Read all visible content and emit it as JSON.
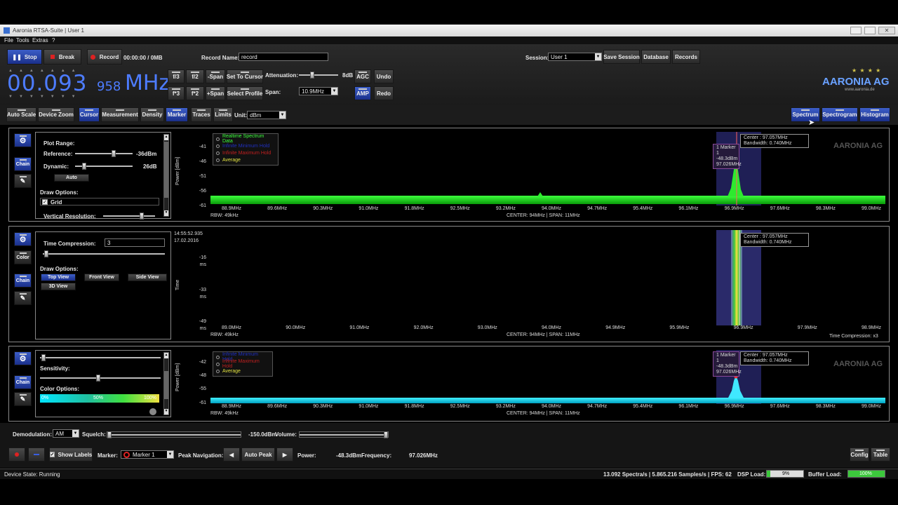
{
  "window": {
    "title": "Aaronia RTSA-Suite | User 1"
  },
  "menu": [
    "File",
    "Tools",
    "Extras",
    "?"
  ],
  "toolbar": {
    "stop": "Stop",
    "break": "Break",
    "record": "Record",
    "time": "00:00:00 / 0MB",
    "record_name_label": "Record Name:",
    "record_name_value": "record",
    "session_label": "Session:",
    "session_value": "User 1",
    "save_session": "Save Session",
    "database": "Database",
    "records": "Records"
  },
  "freq": {
    "main": "00.093",
    "sub": "958",
    "unit": "MHz"
  },
  "freq_buttons": {
    "f3": "f/3",
    "f2": "f/2",
    "mspan": "-Span",
    "set_cursor": "Set To Cursor",
    "x3": "f*3",
    "x2": "f*2",
    "pspan": "+Span",
    "select_profile": "Select Profile"
  },
  "atten": {
    "label": "Attenuation:",
    "value": "8dB",
    "agc": "AGC",
    "amp": "AMP",
    "undo": "Undo",
    "redo": "Redo",
    "span_label": "Span:",
    "span_value": "10.9MHz"
  },
  "logo": {
    "text": "AARONIA AG",
    "sub": "www.aaronia.de"
  },
  "tabs": {
    "auto_scale": "Auto Scale",
    "device_zoom": "Device Zoom",
    "cursor": "Cursor",
    "measurement": "Measurement",
    "density": "Density",
    "marker": "Marker",
    "traces": "Traces",
    "limits": "Limits",
    "unit_label": "Unit:",
    "unit_value": "dBm",
    "spectrum": "Spectrum",
    "spectrogram": "Spectrogram",
    "histogram": "Histogram"
  },
  "side": {
    "chain": "Chain",
    "color": "Color"
  },
  "panel1": {
    "plot_range": "Plot Range:",
    "reference": "Reference:",
    "reference_val": "-36dBm",
    "dynamic": "Dynamic:",
    "dynamic_val": "26dB",
    "auto": "Auto",
    "draw_options": "Draw Options:",
    "grid": "Grid",
    "vres": "Vertical Resolution:",
    "ylabel": "Power [dBm]",
    "yticks": [
      "-41",
      "-46",
      "-51",
      "-56",
      "-61"
    ],
    "xticks": [
      "88.9MHz",
      "89.6MHz",
      "90.3MHz",
      "91.0MHz",
      "91.8MHz",
      "92.5MHz",
      "93.2MHz",
      "94.0MHz",
      "94.7MHz",
      "95.4MHz",
      "96.1MHz",
      "96.9MHz",
      "97.6MHz",
      "98.3MHz",
      "99.0MHz"
    ],
    "rbw": "RBW: 49kHz",
    "center": "CENTER: 94MHz  |  SPAN: 11MHz",
    "legend": [
      "Realtime Spectrum Data",
      "Infinite Minimum Hold",
      "Infinite Maximum Hold",
      "Average"
    ],
    "marker_box": [
      "1 Marker 1",
      "-48.3dBm",
      "97.026MHz"
    ],
    "center_box": [
      "Center     : 97.057MHz",
      "Bandwidth: 0.740MHz"
    ]
  },
  "panel2": {
    "time_compression": "Time Compression:",
    "tc_value": "3",
    "draw_options": "Draw Options:",
    "top_view": "Top View",
    "front_view": "Front View",
    "side_view": "Side View",
    "view_3d": "3D View",
    "timestamp": "14:55:52.935",
    "date": "17.02.2016",
    "ylabel": "Time",
    "yticks": [
      "-16\nms",
      "-33\nms",
      "-49\nms"
    ],
    "ytick_a": "-16",
    "ytick_b": "-33",
    "ytick_c": "-49",
    "ms": "ms",
    "xticks": [
      "89.0MHz",
      "90.0MHz",
      "91.0MHz",
      "92.0MHz",
      "93.0MHz",
      "94.0MHz",
      "94.9MHz",
      "95.9MHz",
      "96.9MHz",
      "97.9MHz",
      "98.9MHz"
    ],
    "rbw": "RBW: 49kHz",
    "center": "CENTER: 94MHz  |  SPAN: 11MHz",
    "tc_footer": "Time Compression: x3",
    "center_box": [
      "Center     : 97.057MHz",
      "Bandwidth: 0.740MHz"
    ]
  },
  "panel3": {
    "sensitivity": "Sensitivity:",
    "color_options": "Color Options:",
    "c0": "0%",
    "c50": "50%",
    "c100": "100%",
    "ylabel": "Power [dBm]",
    "yticks": [
      "-42",
      "-48",
      "-55",
      "-61"
    ],
    "xticks": [
      "88.9MHz",
      "89.6MHz",
      "90.3MHz",
      "91.0MHz",
      "91.8MHz",
      "92.5MHz",
      "93.2MHz",
      "94.0MHz",
      "94.7MHz",
      "95.4MHz",
      "96.1MHz",
      "96.9MHz",
      "97.6MHz",
      "98.3MHz",
      "99.0MHz"
    ],
    "rbw": "RBW: 49kHz",
    "center": "CENTER: 94MHz  |  SPAN: 11MHz",
    "legend": [
      "Infinite Minimum Hold",
      "Infinite Maximum Hold",
      "Average"
    ],
    "marker_box": [
      "1 Marker 1",
      "-48.3dBm",
      "97.026MHz"
    ],
    "center_box": [
      "Center     : 97.057MHz",
      "Bandwidth: 0.740MHz"
    ]
  },
  "bottom": {
    "demod_label": "Demodulation:",
    "demod_value": "AM",
    "squelch_label": "Squelch:",
    "squelch_value": "-150.0dBm",
    "volume_label": "Volume:",
    "show_labels": "Show Labels",
    "marker_label": "Marker:",
    "marker_value": "Marker 1",
    "peak_nav": "Peak Navigation:",
    "auto_peak": "Auto Peak",
    "power_label": "Power:",
    "power_value": "-48.3dBm",
    "freq_label": "Frequency:",
    "freq_value": "97.026MHz",
    "config": "Config",
    "table": "Table"
  },
  "status": {
    "device_state": "Device State: Running",
    "rates": "13.092 Spectra/s  |  5.865.216 Samples/s  |  FPS: 62",
    "dsp_label": "DSP Load:",
    "dsp_value": "9%",
    "dsp_fill": 0.09,
    "buffer_label": "Buffer Load:",
    "buffer_value": "100%",
    "buffer_fill": 1.0
  },
  "colors": {
    "accent": "#2c47b0",
    "spectrum": "#22dd22",
    "heat": "#00e5ff"
  }
}
